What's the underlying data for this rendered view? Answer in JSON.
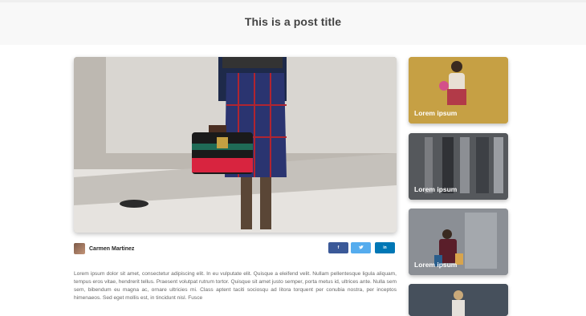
{
  "post": {
    "title": "This is a post title",
    "author": "Carmen Martinez",
    "body": "Lorem ipsum dolor sit amet, consectetur adipiscing elit. In eu vulputate elit. Quisque a eleifend velit. Nullam pellentesque ligula aliquam, tempus eros vitae, hendrerit tellus. Praesent volutpat rutrum tortor. Quisque sit amet justo semper, porta metus id, ultrices ante. Nulla sem sem, bibendum eu magna ac, ornare ultricies mi. Class aptent taciti sociosqu ad litora torquent per conubia nostra, per inceptos himenaeos. Sed eget mollis est, in tincidunt nisl. Fusce"
  },
  "share": {
    "facebook": "f",
    "twitter": "t",
    "linkedin": "in"
  },
  "sidebar": {
    "cards": [
      {
        "label": "Lorem ipsum"
      },
      {
        "label": "Lorem ipsum"
      },
      {
        "label": "Lorem ipsum"
      },
      {
        "label": ""
      }
    ]
  },
  "colors": {
    "facebook": "#3b5998",
    "twitter": "#55acee",
    "linkedin": "#0077b5"
  }
}
